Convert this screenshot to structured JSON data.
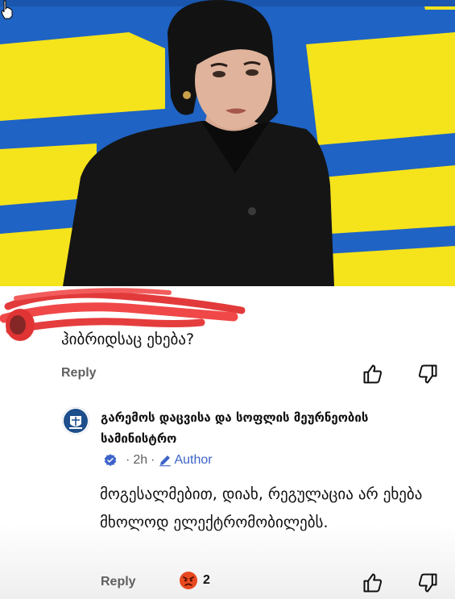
{
  "comment": {
    "text": "ჰიბრიდსაც ეხება?",
    "reply_label": "Reply"
  },
  "reply": {
    "author": "გარემოს დაცვისა და სოფლის მეურნეობის სამინისტრო",
    "time": "2h",
    "separator": "·",
    "author_badge": "Author",
    "text": "მოგესალმებით, დიახ, რეგულაცია არ ეხება მხოლოდ ელექტრომობილებს.",
    "reply_label": "Reply",
    "reaction_count": "2"
  },
  "colors": {
    "text": "#0f0f0f",
    "secondary": "#606060",
    "author_badge": "#3e64c9",
    "video_blue": "#1f63c4",
    "video_yellow": "#f5e31c"
  },
  "icons": [
    "cursor-hand-icon",
    "like-icon",
    "dislike-icon",
    "verified-icon",
    "pencil-icon",
    "angry-emoji-icon",
    "ministry-logo-icon"
  ]
}
